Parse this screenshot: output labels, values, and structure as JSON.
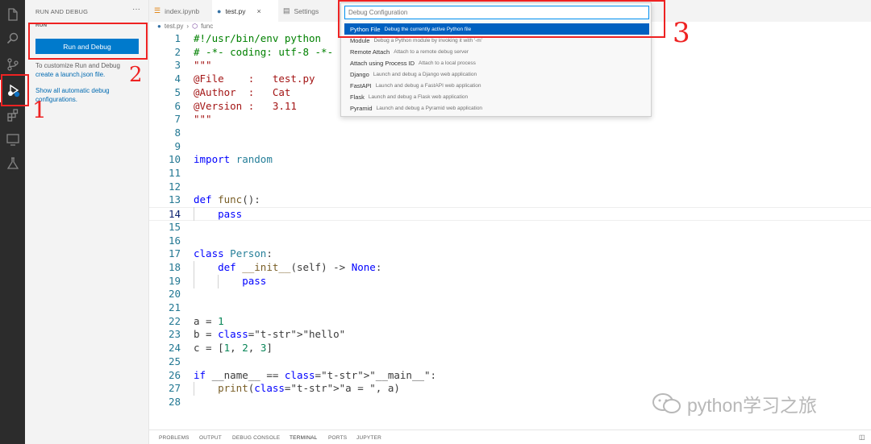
{
  "activity_bar": {
    "items": [
      {
        "icon": "files-icon"
      },
      {
        "icon": "search-icon"
      },
      {
        "icon": "source-control-icon"
      },
      {
        "icon": "run-debug-icon",
        "active": true
      },
      {
        "icon": "extensions-icon"
      },
      {
        "icon": "remote-explorer-icon"
      },
      {
        "icon": "testing-icon"
      }
    ]
  },
  "sidebar": {
    "title": "RUN AND DEBUG",
    "more": "···",
    "section": "RUN",
    "run_button": "Run and Debug",
    "customize_text": "To customize Run and Debug",
    "customize_link": "create a launch.json file.",
    "show_all_link": "Show all automatic debug configurations."
  },
  "tabs": [
    {
      "label": "index.ipynb",
      "icon": "notebook-icon"
    },
    {
      "label": "test.py",
      "icon": "python-icon",
      "active": true,
      "close": "×"
    },
    {
      "label": "Settings",
      "icon": "settings-file-icon"
    }
  ],
  "breadcrumb": {
    "file": "test.py",
    "sep": "›",
    "symbol": "func"
  },
  "editor": {
    "current_line": 14,
    "lines": [
      {
        "n": "1",
        "code": "#!/usr/bin/env python"
      },
      {
        "n": "2",
        "code": "# -*- coding: utf-8 -*-"
      },
      {
        "n": "3",
        "code": "\"\"\""
      },
      {
        "n": "4",
        "code": "@File    :   test.py"
      },
      {
        "n": "5",
        "code": "@Author  :   Cat"
      },
      {
        "n": "6",
        "code": "@Version :   3.11"
      },
      {
        "n": "7",
        "code": "\"\"\""
      },
      {
        "n": "8",
        "code": ""
      },
      {
        "n": "9",
        "code": ""
      },
      {
        "n": "10",
        "code": "import random"
      },
      {
        "n": "11",
        "code": ""
      },
      {
        "n": "12",
        "code": ""
      },
      {
        "n": "13",
        "code": "def func():"
      },
      {
        "n": "14",
        "code": "    pass"
      },
      {
        "n": "15",
        "code": ""
      },
      {
        "n": "16",
        "code": ""
      },
      {
        "n": "17",
        "code": "class Person:"
      },
      {
        "n": "18",
        "code": "    def __init__(self) -> None:"
      },
      {
        "n": "19",
        "code": "        pass"
      },
      {
        "n": "20",
        "code": ""
      },
      {
        "n": "21",
        "code": ""
      },
      {
        "n": "22",
        "code": "a = 1"
      },
      {
        "n": "23",
        "code": "b = \"hello\""
      },
      {
        "n": "24",
        "code": "c = [1, 2, 3]"
      },
      {
        "n": "25",
        "code": ""
      },
      {
        "n": "26",
        "code": "if __name__ == \"__main__\":"
      },
      {
        "n": "27",
        "code": "    print(\"a = \", a)"
      },
      {
        "n": "28",
        "code": ""
      }
    ]
  },
  "quick_pick": {
    "placeholder": "Debug Configuration",
    "items": [
      {
        "label": "Python File",
        "desc": "Debug the currently active Python file",
        "selected": true
      },
      {
        "label": "Module",
        "desc": "Debug a Python module by invoking it with '-m'"
      },
      {
        "label": "Remote Attach",
        "desc": "Attach to a remote debug server"
      },
      {
        "label": "Attach using Process ID",
        "desc": "Attach to a local process"
      },
      {
        "label": "Django",
        "desc": "Launch and debug a Django web application"
      },
      {
        "label": "FastAPI",
        "desc": "Launch and debug a FastAPI web application"
      },
      {
        "label": "Flask",
        "desc": "Launch and debug a Flask web application"
      },
      {
        "label": "Pyramid",
        "desc": "Launch and debug a Pyramid web application"
      }
    ]
  },
  "panel_tabs": [
    "PROBLEMS",
    "OUTPUT",
    "DEBUG CONSOLE",
    "TERMINAL",
    "PORTS",
    "JUPYTER"
  ],
  "annotations": {
    "one": "1",
    "two": "2",
    "three": "3"
  },
  "watermark": "python学习之旅",
  "colors": {
    "accent": "#007acc",
    "annotation": "#ee2222",
    "selection": "#0060c0"
  }
}
